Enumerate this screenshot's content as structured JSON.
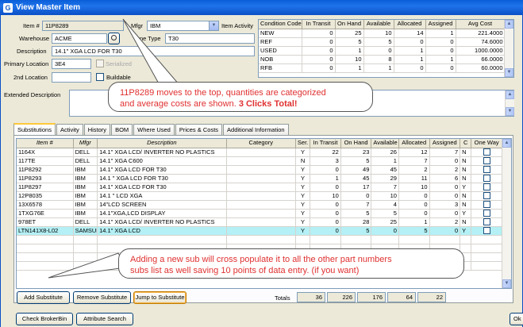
{
  "window": {
    "title": "View Master Item"
  },
  "form": {
    "item_label": "Item #",
    "item_value": "11P8289",
    "mfgr_label": "Mfgr",
    "mfgr_value": "IBM",
    "item_activity_label": "Item Activity",
    "warehouse_label": "Warehouse",
    "warehouse_value": "ACME",
    "type_label": "ne Type",
    "type_value": "T30",
    "description_label": "Description",
    "description_value": "14.1\" XGA LCD FOR T30",
    "primary_location_label": "Primary Location",
    "primary_location_value": "3E4",
    "serialized_label": "Serialized",
    "second_location_label": "2nd Location",
    "second_location_value": "",
    "buildable_label": "Buildable",
    "ext_desc_label": "Extended Description",
    "ext_desc_value": ""
  },
  "condition_table": {
    "headers": [
      "Condition Code",
      "In Transit",
      "On Hand",
      "Available",
      "Allocated",
      "Assigned",
      "Avg Cost"
    ],
    "rows": [
      [
        "NEW",
        "0",
        "25",
        "10",
        "14",
        "1",
        "221.4000"
      ],
      [
        "REF",
        "0",
        "5",
        "5",
        "0",
        "0",
        "74.6000"
      ],
      [
        "USED",
        "0",
        "1",
        "0",
        "1",
        "0",
        "1000.0000"
      ],
      [
        "NOB",
        "0",
        "10",
        "8",
        "1",
        "1",
        "66.0000"
      ],
      [
        "RFB",
        "0",
        "1",
        "1",
        "0",
        "0",
        "60.0000"
      ]
    ]
  },
  "callouts": {
    "top_line1": "11P8289 moves to the top, quantities are categorized",
    "top_line2": "and average costs are shown. ",
    "top_bold": "3 Clicks Total!",
    "bottom_line1": "Adding a new sub will cross populate it to all the other part numbers",
    "bottom_line2": "subs list as well saving 10 points of data entry. (if you want)"
  },
  "tabs": [
    "Substitutions",
    "Activity",
    "History",
    "BOM",
    "Where Used",
    "Prices & Costs",
    "Additional Information"
  ],
  "subs_table": {
    "headers": [
      "Item #",
      "Mfgr",
      "Description",
      "Category",
      "Ser.",
      "In Transit",
      "On Hand",
      "Available",
      "Allocated",
      "Assigned",
      "C",
      "One Way"
    ],
    "rows": [
      [
        "1164X",
        "DELL",
        "14.1\" XGA LCD/ INVERTER NO PLASTICS",
        "",
        "Y",
        "22",
        "23",
        "26",
        "12",
        "7",
        "N"
      ],
      [
        "117TE",
        "DELL",
        "14.1\" XGA C600",
        "",
        "N",
        "3",
        "5",
        "1",
        "7",
        "0",
        "N"
      ],
      [
        "11P8292",
        "IBM",
        "14.1\" XGA LCD FOR T30",
        "",
        "Y",
        "0",
        "49",
        "45",
        "2",
        "2",
        "N"
      ],
      [
        "11P8293",
        "IBM",
        "14.1 \" XGA LCD FOR T30",
        "",
        "Y",
        "1",
        "45",
        "29",
        "11",
        "6",
        "N"
      ],
      [
        "11P8297",
        "IBM",
        "14.1\" XGA LCD FOR T30",
        "",
        "Y",
        "0",
        "17",
        "7",
        "10",
        "0",
        "Y"
      ],
      [
        "12P8035",
        "IBM",
        "14.1 \" LCD XGA",
        "",
        "Y",
        "10",
        "0",
        "10",
        "0",
        "0",
        "N"
      ],
      [
        "13X6578",
        "IBM",
        "14\"LCD SCREEN",
        "",
        "Y",
        "0",
        "7",
        "4",
        "0",
        "3",
        "N"
      ],
      [
        "1TXG76E",
        "IBM",
        "14.1\"XGA,LCD DISPLAY",
        "",
        "Y",
        "0",
        "5",
        "5",
        "0",
        "0",
        "Y"
      ],
      [
        "978ET",
        "DELL",
        "14.1\" XGA LCD/ INVERTER NO PLASTICS",
        "",
        "Y",
        "0",
        "28",
        "25",
        "1",
        "2",
        "N"
      ],
      [
        "LTN141X8-L02",
        "SAMSUN",
        "14.1\" XGA LCD",
        "",
        "Y",
        "0",
        "5",
        "0",
        "5",
        "0",
        "Y"
      ]
    ]
  },
  "buttons": {
    "add_substitute": "Add Substitute",
    "remove_substitute": "Remove Substitute",
    "jump_to_substitute": "Jump to Substitute",
    "check_brokerbin": "Check BrokerBin",
    "attribute_search": "Attribute Search",
    "ok_partial": "Ok"
  },
  "totals": {
    "label": "Totals",
    "values": [
      "36",
      "226",
      "176",
      "64",
      "22"
    ]
  }
}
